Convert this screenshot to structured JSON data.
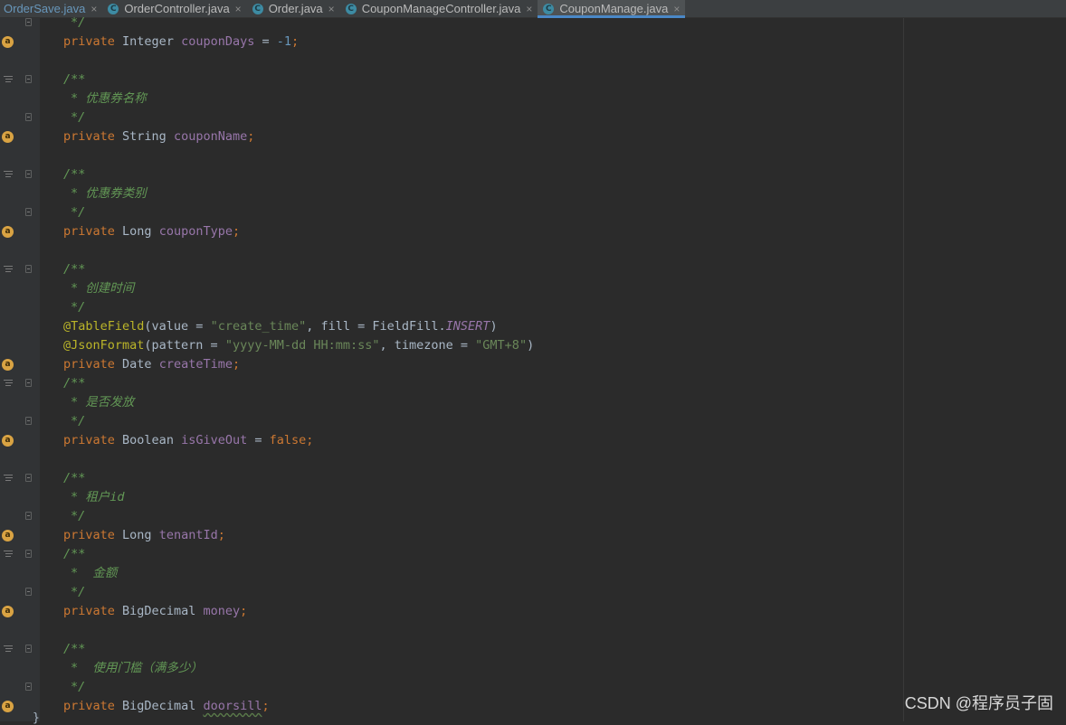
{
  "tabs": [
    {
      "label": "OrderSave.java",
      "active": false
    },
    {
      "label": "OrderController.java",
      "active": false
    },
    {
      "label": "Order.java",
      "active": false
    },
    {
      "label": "CouponManageController.java",
      "active": false
    },
    {
      "label": "CouponManage.java",
      "active": true
    }
  ],
  "tab_icon_letter": "C",
  "tab_close": "×",
  "gutter_annotation_letter": "a",
  "code": {
    "l1": "*/",
    "l2": {
      "kw": "private",
      "type": "Integer",
      "name": "couponDays",
      "op": " = ",
      "val": "-1",
      "end": ";"
    },
    "l4": "/**",
    "l5": "* 优惠券名称",
    "l6": "*/",
    "l7": {
      "kw": "private",
      "type": "String",
      "name": "couponName",
      "end": ";"
    },
    "l9": "/**",
    "l10": "* 优惠券类别",
    "l11": "*/",
    "l12": {
      "kw": "private",
      "type": "Long",
      "name": "couponType",
      "end": ";"
    },
    "l14": "/**",
    "l15": "* 创建时间",
    "l16": "*/",
    "l17": {
      "ann": "@TableField",
      "p1": "(value = ",
      "s1": "\"create_time\"",
      "p2": ", fill = FieldFill.",
      "it": "INSERT",
      "p3": ")"
    },
    "l18": {
      "ann": "@JsonFormat",
      "p1": "(pattern = ",
      "s1": "\"yyyy-MM-dd HH:mm:ss\"",
      "p2": ", timezone = ",
      "s2": "\"GMT+8\"",
      "p3": ")"
    },
    "l19": {
      "kw": "private",
      "type": "Date",
      "name": "createTime",
      "end": ";"
    },
    "l20": "/**",
    "l21": "* 是否发放",
    "l22": "*/",
    "l23": {
      "kw": "private",
      "type": "Boolean",
      "name": "isGiveOut",
      "op": " = ",
      "val": "false",
      "end": ";"
    },
    "l25": "/**",
    "l26": "* 租户id",
    "l27": "*/",
    "l28": {
      "kw": "private",
      "type": "Long",
      "name": "tenantId",
      "end": ";"
    },
    "l29": "/**",
    "l30": "*  金额",
    "l31": "*/",
    "l32": {
      "kw": "private",
      "type": "BigDecimal",
      "name": "money",
      "end": ";"
    },
    "l34": "/**",
    "l35": "*  使用门槛（满多少）",
    "l36": "*/",
    "l37": {
      "kw": "private",
      "type": "BigDecimal",
      "name": "doorsill",
      "end": ";"
    },
    "l38": "}"
  },
  "watermark": "CSDN @程序员子固"
}
